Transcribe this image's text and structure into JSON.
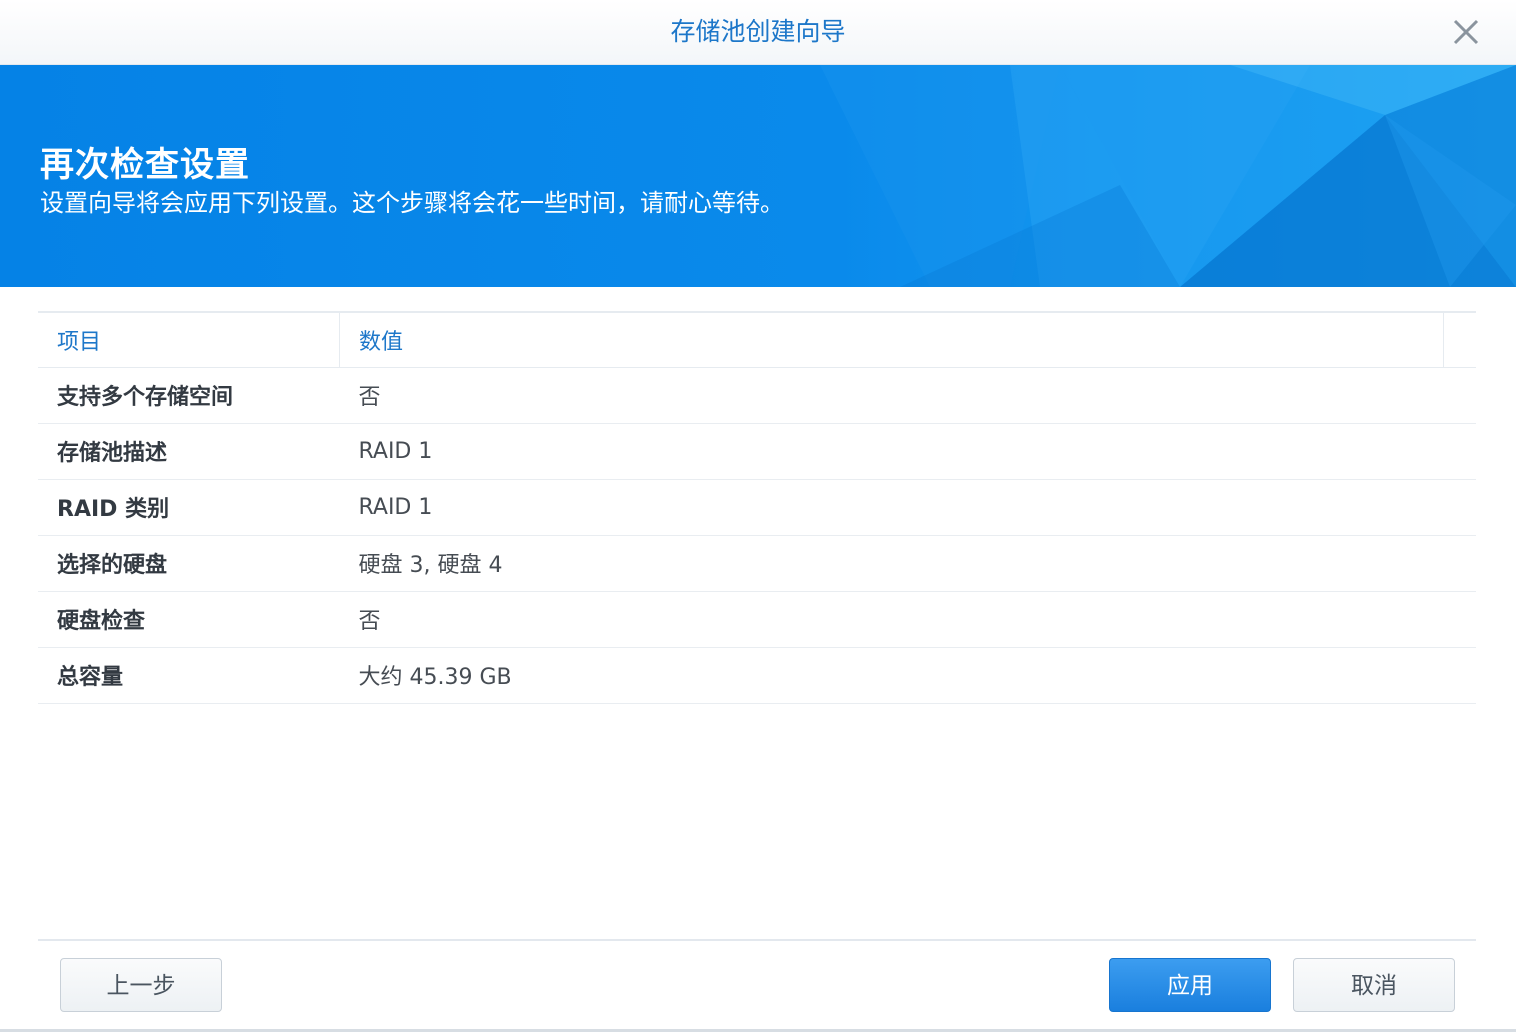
{
  "window": {
    "title": "存储池创建向导",
    "close_icon": "close-icon"
  },
  "banner": {
    "title": "再次检查设置",
    "subtitle": "设置向导将会应用下列设置。这个步骤将会花一些时间，请耐心等待。",
    "background_color": "#0a87e8"
  },
  "table": {
    "headers": {
      "item": "项目",
      "value": "数值"
    },
    "rows": [
      {
        "item": "支持多个存储空间",
        "value": "否"
      },
      {
        "item": "存储池描述",
        "value": "RAID 1"
      },
      {
        "item": "RAID 类别",
        "value": "RAID 1"
      },
      {
        "item": "选择的硬盘",
        "value": "硬盘 3, 硬盘 4"
      },
      {
        "item": "硬盘检查",
        "value": "否"
      },
      {
        "item": "总容量",
        "value": "大约 45.39 GB"
      }
    ]
  },
  "footer": {
    "back_label": "上一步",
    "apply_label": "应用",
    "cancel_label": "取消"
  },
  "colors": {
    "accent": "#1d77c9",
    "primary_button": "#1a7fde"
  }
}
